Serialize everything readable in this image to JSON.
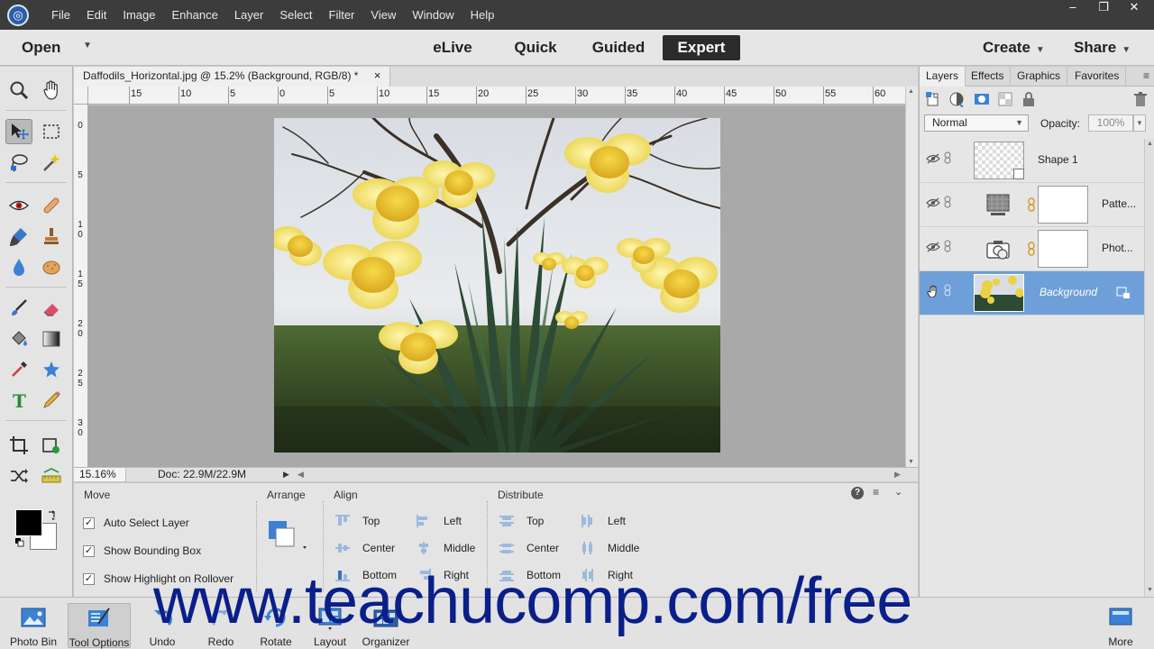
{
  "menubar": {
    "items": [
      "File",
      "Edit",
      "Image",
      "Enhance",
      "Layer",
      "Select",
      "Filter",
      "View",
      "Window",
      "Help"
    ]
  },
  "modebar": {
    "open_label": "Open",
    "tabs": [
      "eLive",
      "Quick",
      "Guided",
      "Expert"
    ],
    "active_tab": "Expert",
    "create_label": "Create",
    "share_label": "Share"
  },
  "document": {
    "tab_title": "Daffodils_Horizontal.jpg @ 15.2% (Background, RGB/8) *",
    "close_glyph": "×",
    "zoom": "15.16%",
    "doc_info": "Doc: 22.9M/22.9M"
  },
  "rulers": {
    "top_labels": [
      "15",
      "10",
      "5",
      "0",
      "5",
      "10",
      "15",
      "20",
      "25",
      "30",
      "35",
      "40",
      "45",
      "50",
      "55",
      "60"
    ],
    "left_labels": [
      "0",
      "5",
      "1\n0",
      "1\n5",
      "2\n0",
      "2\n5",
      "3\n0"
    ]
  },
  "tool_options": {
    "move_heading": "Move",
    "checks": [
      {
        "label": "Auto Select Layer",
        "checked": true
      },
      {
        "label": "Show Bounding Box",
        "checked": true
      },
      {
        "label": "Show Highlight on Rollover",
        "checked": true
      }
    ],
    "arrange_heading": "Arrange",
    "align_heading": "Align",
    "align_col1": [
      "Top",
      "Center",
      "Bottom"
    ],
    "align_col2": [
      "Left",
      "Middle",
      "Right"
    ],
    "distribute_heading": "Distribute",
    "distribute_col1": [
      "Top",
      "Center",
      "Bottom"
    ],
    "distribute_col2": [
      "Left",
      "Middle",
      "Right"
    ]
  },
  "panel": {
    "tabs": [
      "Layers",
      "Effects",
      "Graphics",
      "Favorites"
    ],
    "active_tab": "Layers",
    "blend_mode": "Normal",
    "opacity_label": "Opacity:",
    "opacity_value": "100%",
    "layers": [
      {
        "name": "Shape 1",
        "selected": false
      },
      {
        "name": "Patte...",
        "selected": false
      },
      {
        "name": "Phot...",
        "selected": false
      },
      {
        "name": "Background",
        "selected": true
      }
    ]
  },
  "taskbar": {
    "buttons": [
      "Photo Bin",
      "Tool Options",
      "Undo",
      "Redo",
      "Rotate",
      "Layout",
      "Organizer"
    ],
    "more_label": "More"
  },
  "watermark": "www.teachucomp.com/free",
  "colors": {
    "menubar_bg": "#3c3c3c",
    "active_tab_bg": "#2b2b2b",
    "selected_layer": "#6f9fd8",
    "watermark": "#0b1f8a"
  }
}
